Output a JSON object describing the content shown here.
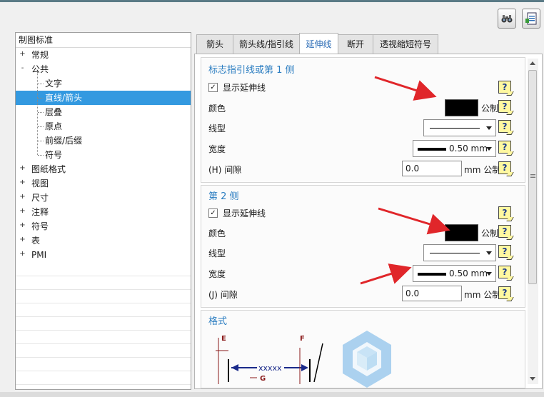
{
  "tree": {
    "header": "制图标准",
    "items": [
      {
        "label": "常规",
        "expander": "+",
        "level": 0
      },
      {
        "label": "公共",
        "expander": "-",
        "level": 0
      },
      {
        "label": "文字",
        "expander": "",
        "level": 1
      },
      {
        "label": "直线/箭头",
        "expander": "",
        "level": 1,
        "selected": true
      },
      {
        "label": "层叠",
        "expander": "",
        "level": 1
      },
      {
        "label": "原点",
        "expander": "",
        "level": 1
      },
      {
        "label": "前缀/后缀",
        "expander": "",
        "level": 1
      },
      {
        "label": "符号",
        "expander": "",
        "level": 1
      },
      {
        "label": "图纸格式",
        "expander": "+",
        "level": 0
      },
      {
        "label": "视图",
        "expander": "+",
        "level": 0
      },
      {
        "label": "尺寸",
        "expander": "+",
        "level": 0
      },
      {
        "label": "注释",
        "expander": "+",
        "level": 0
      },
      {
        "label": "符号",
        "expander": "+",
        "level": 0
      },
      {
        "label": "表",
        "expander": "+",
        "level": 0
      },
      {
        "label": "PMI",
        "expander": "+",
        "level": 0
      }
    ]
  },
  "tabs": [
    "箭头",
    "箭头线/指引线",
    "延伸线",
    "断开",
    "透视缩短符号"
  ],
  "active_tab": 2,
  "side1": {
    "title": "标志指引线或第 1 侧",
    "show_label": "显示延伸线",
    "color_label": "颜色",
    "color_unit": "公制",
    "linetype_label": "线型",
    "width_label": "宽度",
    "width_value": "0.50 mm",
    "gap_label": "(H) 间隙",
    "gap_value": "0.0",
    "gap_unit": "mm 公制"
  },
  "side2": {
    "title": "第 2 侧",
    "show_label": "显示延伸线",
    "color_label": "颜色",
    "color_unit": "公制",
    "linetype_label": "线型",
    "width_label": "宽度",
    "width_value": "0.50 mm",
    "gap_label": "(J) 间隙",
    "gap_value": "0.0",
    "gap_unit": "mm 公制"
  },
  "format": {
    "title": "格式",
    "diagram_labels": {
      "e": "E",
      "f": "F",
      "g": "G",
      "x": "xxxxx"
    }
  },
  "help_glyph": "?",
  "check_glyph": "✓",
  "colors": {
    "accent": "#2b7dc1",
    "selection": "#3399e0",
    "arrow": "#e0262a",
    "swatch": "#000000"
  }
}
